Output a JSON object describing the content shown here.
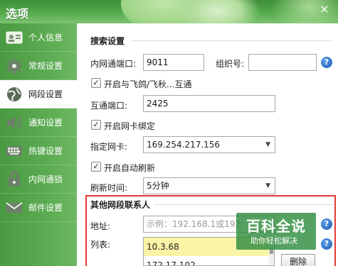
{
  "window": {
    "title": "选项",
    "close_glyph": "×"
  },
  "sidebar": {
    "items": [
      {
        "label": "个人信息",
        "icon": "id-card-icon"
      },
      {
        "label": "常规设置",
        "icon": "gear-icon"
      },
      {
        "label": "网段设置",
        "icon": "globe-icon",
        "active": true
      },
      {
        "label": "通知设置",
        "icon": "speaker-icon"
      },
      {
        "label": "热键设置",
        "icon": "keyboard-icon"
      },
      {
        "label": "内网通锁",
        "icon": "lock-icon"
      },
      {
        "label": "邮件设置",
        "icon": "mail-icon"
      }
    ]
  },
  "search": {
    "title": "搜索设置",
    "port_label": "内网通端口:",
    "port_value": "9011",
    "group_label": "组织号:",
    "group_value": "",
    "interop_label": "开启与飞鸽/飞秋...互通",
    "interop_checked": true,
    "interop_port_label": "互通端口:",
    "interop_port_value": "2425",
    "bind_nic_label": "开启网卡绑定",
    "bind_nic_checked": true,
    "nic_label": "指定网卡:",
    "nic_value": "169.254.217.156",
    "auto_refresh_label": "开启自动刷新",
    "auto_refresh_checked": true,
    "refresh_time_label": "刷新时间:",
    "refresh_time_value": "5分钟",
    "check_glyph": "✓",
    "dropdown_glyph": "▼",
    "help_glyph": "?"
  },
  "contacts": {
    "title": "其他网段联系人",
    "address_label": "地址:",
    "address_placeholder": "示例：192.168.1或192.",
    "list_label": "列表:",
    "list_items": [
      "10.3.68",
      "172.17.102"
    ],
    "delete_label": "删除"
  },
  "watermark": {
    "title": "百科全说",
    "subtitle": "助你轻松解决"
  },
  "colors": {
    "brand_green": "#4ea646",
    "highlight_red": "#e53935",
    "selected_row": "#fbf3a6"
  }
}
